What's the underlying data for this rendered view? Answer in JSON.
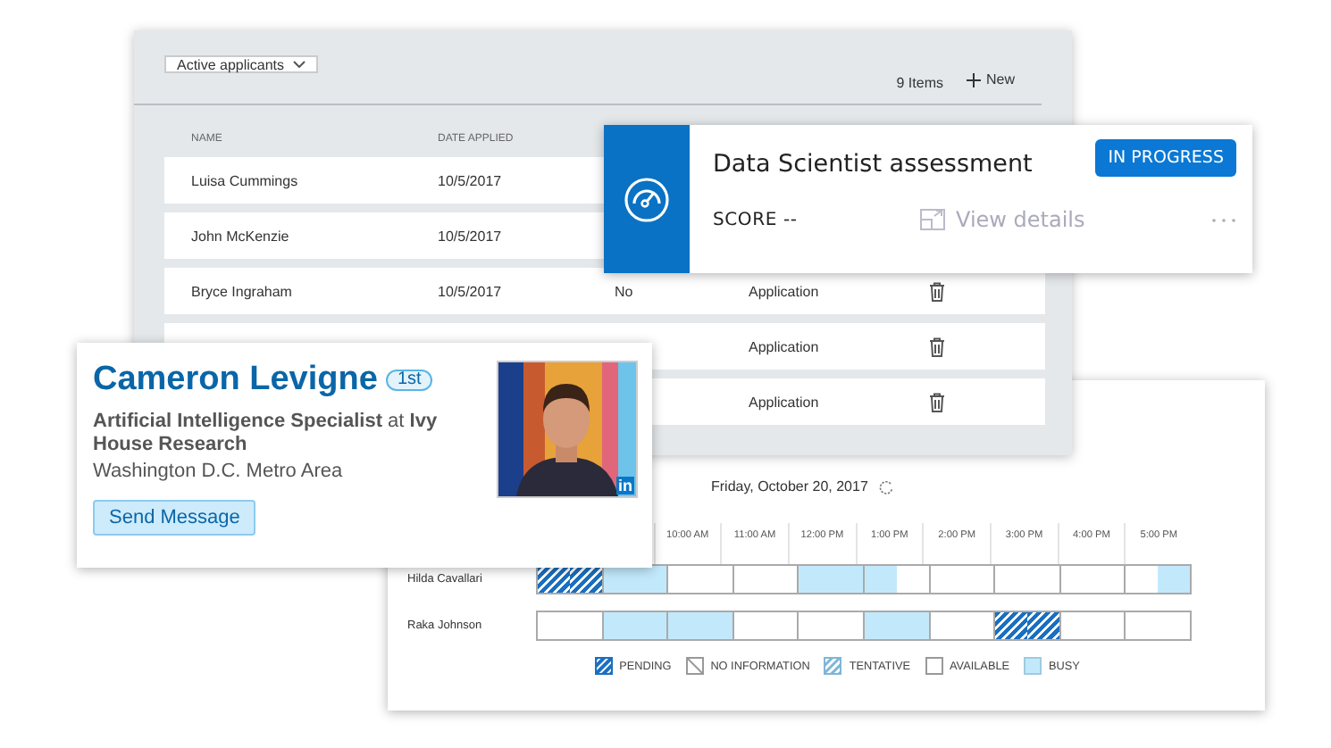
{
  "applicants": {
    "filter": "Active applicants",
    "count": "9 Items",
    "new_button": "New",
    "columns": [
      "NAME",
      "DATE APPLIED"
    ],
    "rows": [
      {
        "name": "Luisa Cummings",
        "date": "10/5/2017"
      },
      {
        "name": "John McKenzie",
        "date": "10/5/2017"
      },
      {
        "name": "Bryce Ingraham",
        "date": "10/5/2017",
        "column_3": "No",
        "stage": "Application"
      },
      {
        "stage": "Application"
      },
      {
        "stage": "Application"
      }
    ]
  },
  "assessment": {
    "title": "Data Scientist assessment",
    "status": "IN PROGRESS",
    "score_label": "SCORE",
    "score": "--",
    "action": "View details"
  },
  "profile": {
    "name": "Cameron Levigne",
    "degree": "1st",
    "headline": "**Artificial Intelligence Specialist** at **Ivy House Research**",
    "location": "Washington D.C. Metro Area",
    "button": "Send Message",
    "photo": {
      "kind": "picture",
      "badge": "in"
    }
  },
  "schedule": {
    "date": "Friday, October 20, 2017",
    "hours": [
      "10:00 AM",
      "11:00 AM",
      "12:00 PM",
      "1:00 PM",
      "2:00 PM",
      "3:00 PM",
      "4:00 PM",
      "5:00 PM"
    ],
    "people": [
      {
        "name": "Hilda Cavallari",
        "slots": [
          {
            "kind": "pending"
          },
          {
            "kind": "pending"
          },
          {
            "kind": "busy"
          },
          {
            "kind": "busy"
          },
          {
            "kind": "available"
          },
          {
            "kind": "available"
          },
          {
            "kind": "available"
          },
          {
            "kind": "available"
          },
          {
            "kind": "busy"
          },
          {
            "kind": "busy"
          },
          {
            "kind": "busy"
          },
          {
            "kind": "available"
          },
          {
            "kind": "available"
          },
          {
            "kind": "available"
          },
          {
            "kind": "available"
          },
          {
            "kind": "available"
          },
          {
            "kind": "available"
          },
          {
            "kind": "available"
          },
          {
            "kind": "available"
          },
          {
            "kind": "busy"
          }
        ]
      },
      {
        "name": "Raka Johnson",
        "slots": [
          {
            "kind": "available"
          },
          {
            "kind": "available"
          },
          {
            "kind": "busy"
          },
          {
            "kind": "busy"
          },
          {
            "kind": "busy"
          },
          {
            "kind": "busy"
          },
          {
            "kind": "available"
          },
          {
            "kind": "available"
          },
          {
            "kind": "available"
          },
          {
            "kind": "available"
          },
          {
            "kind": "busy"
          },
          {
            "kind": "busy"
          },
          {
            "kind": "available"
          },
          {
            "kind": "available"
          },
          {
            "kind": "pending"
          },
          {
            "kind": "pending"
          },
          {
            "kind": "available"
          },
          {
            "kind": "available"
          },
          {
            "kind": "available"
          },
          {
            "kind": "available"
          }
        ]
      }
    ],
    "legend": [
      {
        "kind": "pending",
        "label": "PENDING"
      },
      {
        "kind": "no_information",
        "label": "NO INFORMATION"
      },
      {
        "kind": "tentative",
        "label": "TENTATIVE"
      },
      {
        "kind": "available",
        "label": "AVAILABLE"
      },
      {
        "kind": "busy",
        "label": "BUSY"
      }
    ]
  }
}
